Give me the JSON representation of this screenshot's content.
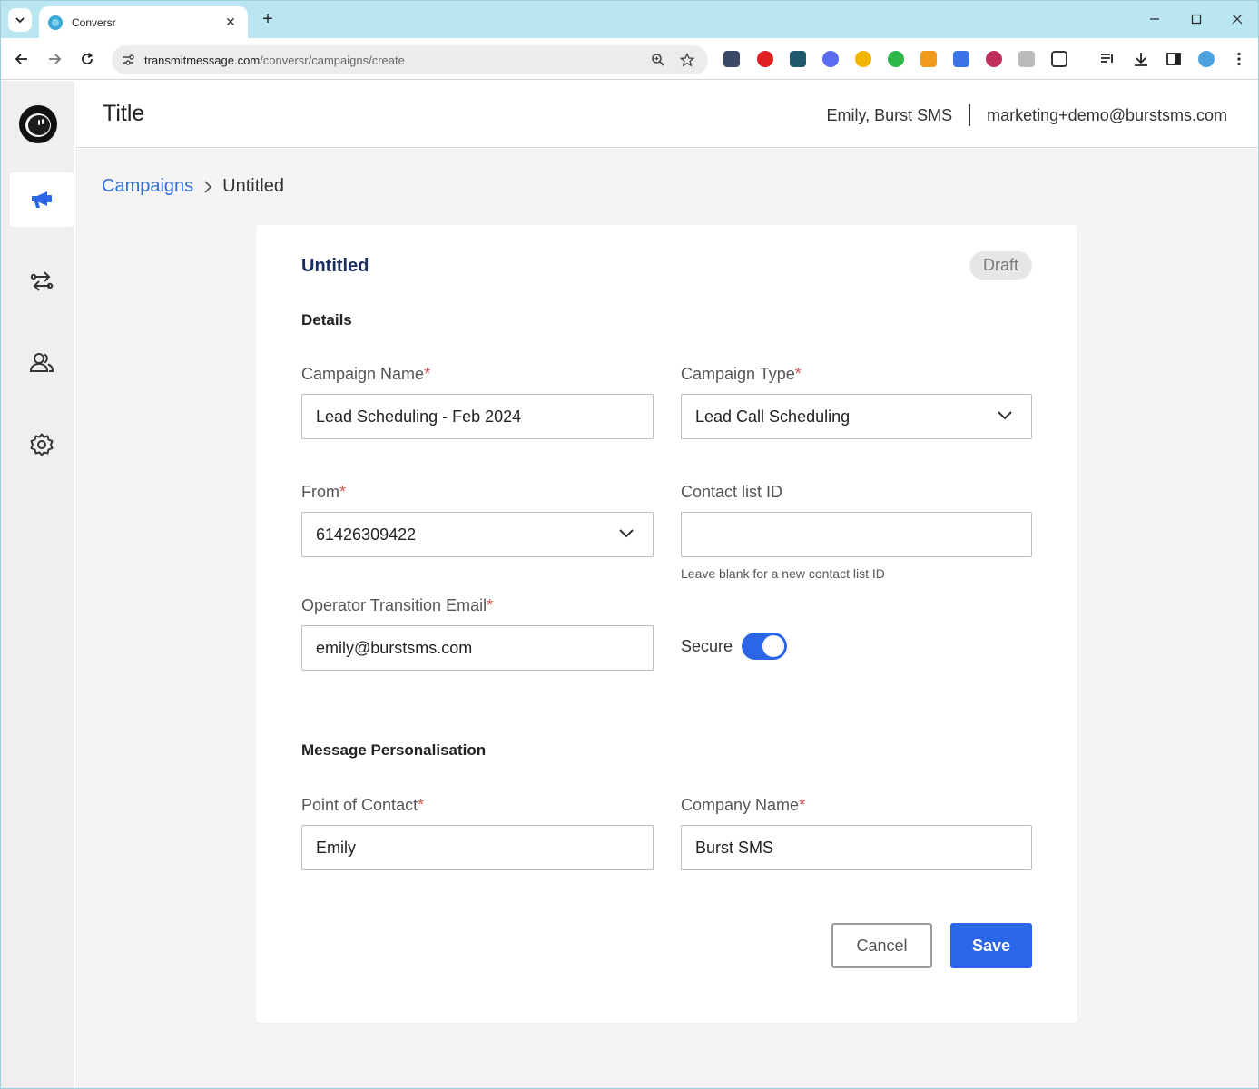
{
  "browser": {
    "tab_title": "Conversr",
    "url_host": "transmitmessage.com",
    "url_path": "/conversr/campaigns/create"
  },
  "header": {
    "title": "Title",
    "user_name": "Emily, Burst SMS",
    "user_email": "marketing+demo@burstsms.com"
  },
  "breadcrumb": {
    "parent": "Campaigns",
    "current": "Untitled"
  },
  "card": {
    "title": "Untitled",
    "status_badge": "Draft",
    "details_heading": "Details",
    "personalisation_heading": "Message Personalisation"
  },
  "form": {
    "campaign_name": {
      "label": "Campaign Name",
      "required": "*",
      "value": "Lead Scheduling - Feb 2024"
    },
    "campaign_type": {
      "label": "Campaign Type",
      "required": "*",
      "value": "Lead Call Scheduling"
    },
    "from": {
      "label": "From",
      "required": "*",
      "value": "61426309422"
    },
    "contact_list_id": {
      "label": "Contact list ID",
      "value": "",
      "hint": "Leave blank for a new contact list ID"
    },
    "operator_email": {
      "label": "Operator Transition Email",
      "required": "*",
      "value": "emily@burstsms.com"
    },
    "secure": {
      "label": "Secure",
      "enabled": true
    },
    "point_of_contact": {
      "label": "Point of Contact",
      "required": "*",
      "value": "Emily"
    },
    "company_name": {
      "label": "Company Name",
      "required": "*",
      "value": "Burst SMS"
    }
  },
  "actions": {
    "cancel_label": "Cancel",
    "save_label": "Save"
  },
  "colors": {
    "accent": "#2b65e8",
    "link": "#2e6fd8",
    "required": "#d9534f",
    "card_title": "#1b2e5e"
  }
}
